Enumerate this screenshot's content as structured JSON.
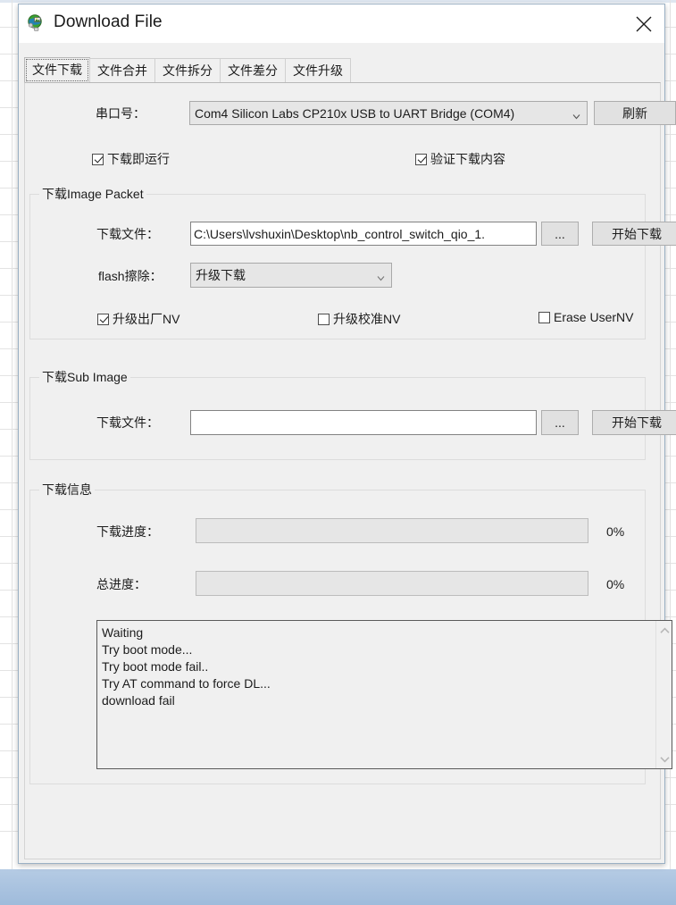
{
  "window": {
    "title": "Download File",
    "icon": "globe-network-icon",
    "close_label": "✕"
  },
  "tabs": [
    {
      "label": "文件下载",
      "selected": true
    },
    {
      "label": "文件合并",
      "selected": false
    },
    {
      "label": "文件拆分",
      "selected": false
    },
    {
      "label": "文件差分",
      "selected": false
    },
    {
      "label": "文件升级",
      "selected": false
    }
  ],
  "serial": {
    "label": "串口号：",
    "value": "Com4 Silicon Labs CP210x USB to UART Bridge (COM4)",
    "refresh_label": "刷新"
  },
  "top_options": {
    "run_after_download": {
      "label": "下载即运行",
      "checked": true
    },
    "verify_content": {
      "label": "验证下载内容",
      "checked": true
    }
  },
  "image_packet": {
    "group_title": "下载Image Packet",
    "file_label": "下载文件：",
    "file_value": "C:\\Users\\lvshuxin\\Desktop\\nb_control_switch_qio_1.",
    "browse_label": "...",
    "start_label": "开始下载",
    "flash_label": "flash擦除：",
    "flash_value": "升级下载",
    "checkboxes": [
      {
        "label": "升级出厂NV",
        "checked": true
      },
      {
        "label": "升级校准NV",
        "checked": false
      },
      {
        "label": "Erase UserNV",
        "checked": false
      }
    ]
  },
  "sub_image": {
    "group_title": "下载Sub Image",
    "file_label": "下载文件：",
    "file_value": "",
    "browse_label": "...",
    "start_label": "开始下载"
  },
  "download_info": {
    "group_title": "下载信息",
    "progress_label": "下载进度：",
    "progress_percent": "0%",
    "progress_value": 0,
    "total_label": "总进度：",
    "total_percent": "0%",
    "total_value": 0,
    "log": "Waiting\nTry boot mode...\nTry boot mode fail..\nTry AT command to force DL...\ndownload fail"
  },
  "colors": {
    "window_bg": "#f0f0f0",
    "titlebar_bg": "#ffffff",
    "border": "#d4d4d4",
    "text": "#1c1c1c",
    "field_bg": "#ffffff",
    "combo_bg": "#e6e6e6",
    "button_bg": "#e1e1e1",
    "progress_fill": "#06b025"
  }
}
